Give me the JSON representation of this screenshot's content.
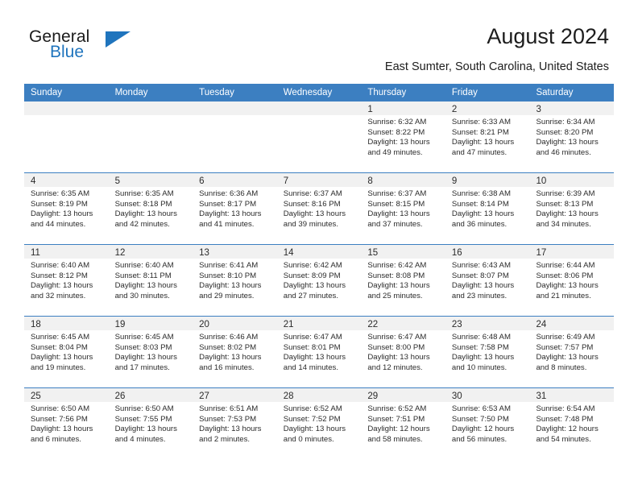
{
  "brand": {
    "name_general": "General",
    "name_blue": "Blue",
    "accent_color": "#1f74bd"
  },
  "header": {
    "title": "August 2024",
    "subtitle": "East Sumter, South Carolina, United States"
  },
  "calendar": {
    "header_bg": "#3c7fc1",
    "daynum_band_bg": "#f1f1f1",
    "weekdays": [
      "Sunday",
      "Monday",
      "Tuesday",
      "Wednesday",
      "Thursday",
      "Friday",
      "Saturday"
    ],
    "weeks": [
      [
        {
          "day": "",
          "sunrise": "",
          "sunset": "",
          "daylight_a": "",
          "daylight_b": "",
          "empty": true
        },
        {
          "day": "",
          "sunrise": "",
          "sunset": "",
          "daylight_a": "",
          "daylight_b": "",
          "empty": true
        },
        {
          "day": "",
          "sunrise": "",
          "sunset": "",
          "daylight_a": "",
          "daylight_b": "",
          "empty": true
        },
        {
          "day": "",
          "sunrise": "",
          "sunset": "",
          "daylight_a": "",
          "daylight_b": "",
          "empty": true
        },
        {
          "day": "1",
          "sunrise": "Sunrise: 6:32 AM",
          "sunset": "Sunset: 8:22 PM",
          "daylight_a": "Daylight: 13 hours",
          "daylight_b": "and 49 minutes."
        },
        {
          "day": "2",
          "sunrise": "Sunrise: 6:33 AM",
          "sunset": "Sunset: 8:21 PM",
          "daylight_a": "Daylight: 13 hours",
          "daylight_b": "and 47 minutes."
        },
        {
          "day": "3",
          "sunrise": "Sunrise: 6:34 AM",
          "sunset": "Sunset: 8:20 PM",
          "daylight_a": "Daylight: 13 hours",
          "daylight_b": "and 46 minutes."
        }
      ],
      [
        {
          "day": "4",
          "sunrise": "Sunrise: 6:35 AM",
          "sunset": "Sunset: 8:19 PM",
          "daylight_a": "Daylight: 13 hours",
          "daylight_b": "and 44 minutes."
        },
        {
          "day": "5",
          "sunrise": "Sunrise: 6:35 AM",
          "sunset": "Sunset: 8:18 PM",
          "daylight_a": "Daylight: 13 hours",
          "daylight_b": "and 42 minutes."
        },
        {
          "day": "6",
          "sunrise": "Sunrise: 6:36 AM",
          "sunset": "Sunset: 8:17 PM",
          "daylight_a": "Daylight: 13 hours",
          "daylight_b": "and 41 minutes."
        },
        {
          "day": "7",
          "sunrise": "Sunrise: 6:37 AM",
          "sunset": "Sunset: 8:16 PM",
          "daylight_a": "Daylight: 13 hours",
          "daylight_b": "and 39 minutes."
        },
        {
          "day": "8",
          "sunrise": "Sunrise: 6:37 AM",
          "sunset": "Sunset: 8:15 PM",
          "daylight_a": "Daylight: 13 hours",
          "daylight_b": "and 37 minutes."
        },
        {
          "day": "9",
          "sunrise": "Sunrise: 6:38 AM",
          "sunset": "Sunset: 8:14 PM",
          "daylight_a": "Daylight: 13 hours",
          "daylight_b": "and 36 minutes."
        },
        {
          "day": "10",
          "sunrise": "Sunrise: 6:39 AM",
          "sunset": "Sunset: 8:13 PM",
          "daylight_a": "Daylight: 13 hours",
          "daylight_b": "and 34 minutes."
        }
      ],
      [
        {
          "day": "11",
          "sunrise": "Sunrise: 6:40 AM",
          "sunset": "Sunset: 8:12 PM",
          "daylight_a": "Daylight: 13 hours",
          "daylight_b": "and 32 minutes."
        },
        {
          "day": "12",
          "sunrise": "Sunrise: 6:40 AM",
          "sunset": "Sunset: 8:11 PM",
          "daylight_a": "Daylight: 13 hours",
          "daylight_b": "and 30 minutes."
        },
        {
          "day": "13",
          "sunrise": "Sunrise: 6:41 AM",
          "sunset": "Sunset: 8:10 PM",
          "daylight_a": "Daylight: 13 hours",
          "daylight_b": "and 29 minutes."
        },
        {
          "day": "14",
          "sunrise": "Sunrise: 6:42 AM",
          "sunset": "Sunset: 8:09 PM",
          "daylight_a": "Daylight: 13 hours",
          "daylight_b": "and 27 minutes."
        },
        {
          "day": "15",
          "sunrise": "Sunrise: 6:42 AM",
          "sunset": "Sunset: 8:08 PM",
          "daylight_a": "Daylight: 13 hours",
          "daylight_b": "and 25 minutes."
        },
        {
          "day": "16",
          "sunrise": "Sunrise: 6:43 AM",
          "sunset": "Sunset: 8:07 PM",
          "daylight_a": "Daylight: 13 hours",
          "daylight_b": "and 23 minutes."
        },
        {
          "day": "17",
          "sunrise": "Sunrise: 6:44 AM",
          "sunset": "Sunset: 8:06 PM",
          "daylight_a": "Daylight: 13 hours",
          "daylight_b": "and 21 minutes."
        }
      ],
      [
        {
          "day": "18",
          "sunrise": "Sunrise: 6:45 AM",
          "sunset": "Sunset: 8:04 PM",
          "daylight_a": "Daylight: 13 hours",
          "daylight_b": "and 19 minutes."
        },
        {
          "day": "19",
          "sunrise": "Sunrise: 6:45 AM",
          "sunset": "Sunset: 8:03 PM",
          "daylight_a": "Daylight: 13 hours",
          "daylight_b": "and 17 minutes."
        },
        {
          "day": "20",
          "sunrise": "Sunrise: 6:46 AM",
          "sunset": "Sunset: 8:02 PM",
          "daylight_a": "Daylight: 13 hours",
          "daylight_b": "and 16 minutes."
        },
        {
          "day": "21",
          "sunrise": "Sunrise: 6:47 AM",
          "sunset": "Sunset: 8:01 PM",
          "daylight_a": "Daylight: 13 hours",
          "daylight_b": "and 14 minutes."
        },
        {
          "day": "22",
          "sunrise": "Sunrise: 6:47 AM",
          "sunset": "Sunset: 8:00 PM",
          "daylight_a": "Daylight: 13 hours",
          "daylight_b": "and 12 minutes."
        },
        {
          "day": "23",
          "sunrise": "Sunrise: 6:48 AM",
          "sunset": "Sunset: 7:58 PM",
          "daylight_a": "Daylight: 13 hours",
          "daylight_b": "and 10 minutes."
        },
        {
          "day": "24",
          "sunrise": "Sunrise: 6:49 AM",
          "sunset": "Sunset: 7:57 PM",
          "daylight_a": "Daylight: 13 hours",
          "daylight_b": "and 8 minutes."
        }
      ],
      [
        {
          "day": "25",
          "sunrise": "Sunrise: 6:50 AM",
          "sunset": "Sunset: 7:56 PM",
          "daylight_a": "Daylight: 13 hours",
          "daylight_b": "and 6 minutes."
        },
        {
          "day": "26",
          "sunrise": "Sunrise: 6:50 AM",
          "sunset": "Sunset: 7:55 PM",
          "daylight_a": "Daylight: 13 hours",
          "daylight_b": "and 4 minutes."
        },
        {
          "day": "27",
          "sunrise": "Sunrise: 6:51 AM",
          "sunset": "Sunset: 7:53 PM",
          "daylight_a": "Daylight: 13 hours",
          "daylight_b": "and 2 minutes."
        },
        {
          "day": "28",
          "sunrise": "Sunrise: 6:52 AM",
          "sunset": "Sunset: 7:52 PM",
          "daylight_a": "Daylight: 13 hours",
          "daylight_b": "and 0 minutes."
        },
        {
          "day": "29",
          "sunrise": "Sunrise: 6:52 AM",
          "sunset": "Sunset: 7:51 PM",
          "daylight_a": "Daylight: 12 hours",
          "daylight_b": "and 58 minutes."
        },
        {
          "day": "30",
          "sunrise": "Sunrise: 6:53 AM",
          "sunset": "Sunset: 7:50 PM",
          "daylight_a": "Daylight: 12 hours",
          "daylight_b": "and 56 minutes."
        },
        {
          "day": "31",
          "sunrise": "Sunrise: 6:54 AM",
          "sunset": "Sunset: 7:48 PM",
          "daylight_a": "Daylight: 12 hours",
          "daylight_b": "and 54 minutes."
        }
      ]
    ]
  }
}
